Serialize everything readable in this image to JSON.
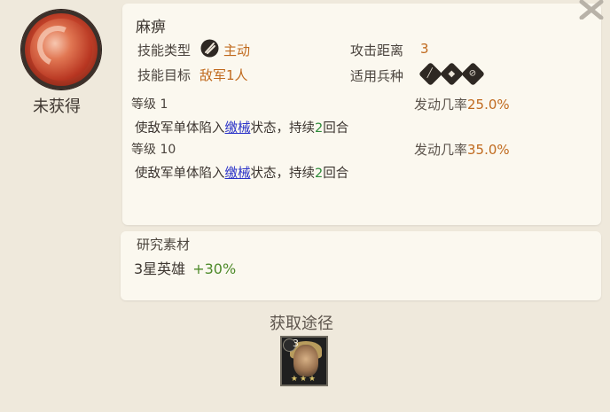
{
  "skill": {
    "name": "麻痹",
    "status": "未获得",
    "type_label": "技能类型",
    "type_value": "主动",
    "range_label": "攻击距离",
    "range_value": "3",
    "target_label": "技能目标",
    "target_value": "敌军1人",
    "troops_label": "适用兵种",
    "troop_icons": [
      {
        "name": "infantry-icon",
        "glyph": "╱"
      },
      {
        "name": "cavalry-icon",
        "glyph": "◆"
      },
      {
        "name": "archer-icon",
        "glyph": "⊘"
      }
    ]
  },
  "levels": [
    {
      "label": "等级 1",
      "rate_label": "发动几率",
      "rate_value": "25.0%",
      "desc_before": "使敌军单体陷入",
      "desc_link": "缴械",
      "desc_middle": "状态，持续",
      "desc_number": "2",
      "desc_after": "回合"
    },
    {
      "label": "等级 10",
      "rate_label": "发动几率",
      "rate_value": "35.0%",
      "desc_before": "使敌军单体陷入",
      "desc_link": "缴械",
      "desc_middle": "状态，持续",
      "desc_number": "2",
      "desc_after": "回合"
    }
  ],
  "materials": {
    "title": "研究素材",
    "item": "3星英雄",
    "bonus": "+30%"
  },
  "source": {
    "title": "获取途径",
    "hero_star": "3"
  },
  "colors": {
    "accent": "#c06a1e",
    "link": "#2a32c8",
    "number": "#2e8b3a",
    "bonus": "#4e8a2a"
  }
}
